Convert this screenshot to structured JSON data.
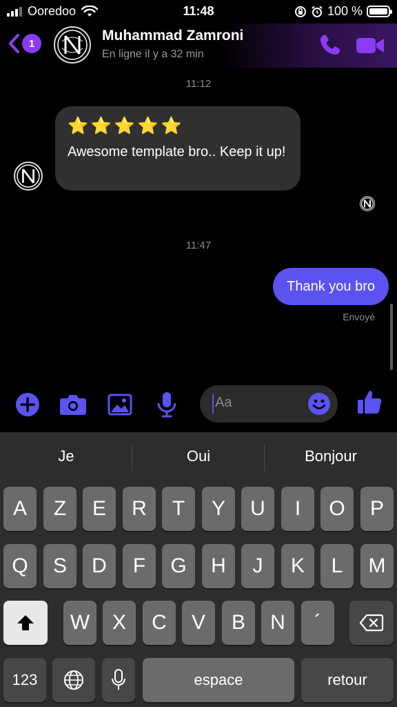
{
  "status_bar": {
    "carrier": "Ooredoo",
    "time": "11:48",
    "battery": "100 %"
  },
  "header": {
    "back_badge": "1",
    "contact_name": "Muhammad Zamroni",
    "presence": "En ligne il y a 32 min",
    "icons": [
      "back-chevron-icon",
      "phone-icon",
      "video-camera-icon"
    ],
    "accent_color": "#8a3cf2"
  },
  "conversation": {
    "timestamp_1": "11:12",
    "incoming": {
      "stars": [
        "⭐",
        "⭐",
        "⭐",
        "⭐",
        "⭐"
      ],
      "text": "Awesome template bro.. Keep it up!"
    },
    "timestamp_2": "11:47",
    "outgoing": {
      "text": "Thank you bro",
      "status": "Envoyé",
      "bubble_color": "#5b52f0"
    }
  },
  "composer": {
    "icons": [
      "plus-icon",
      "camera-icon",
      "image-icon",
      "microphone-icon",
      "emoji-icon",
      "thumbs-up-icon"
    ],
    "placeholder": "Aa",
    "icon_color": "#5b52f0"
  },
  "keyboard": {
    "suggestions": [
      "Je",
      "Oui",
      "Bonjour"
    ],
    "row1": [
      "A",
      "Z",
      "E",
      "R",
      "T",
      "Y",
      "U",
      "I",
      "O",
      "P"
    ],
    "row2": [
      "Q",
      "S",
      "D",
      "F",
      "G",
      "H",
      "J",
      "K",
      "L",
      "M"
    ],
    "row3": [
      "W",
      "X",
      "C",
      "V",
      "B",
      "N",
      "´"
    ],
    "numbers_key": "123",
    "space_key": "espace",
    "return_key": "retour"
  }
}
